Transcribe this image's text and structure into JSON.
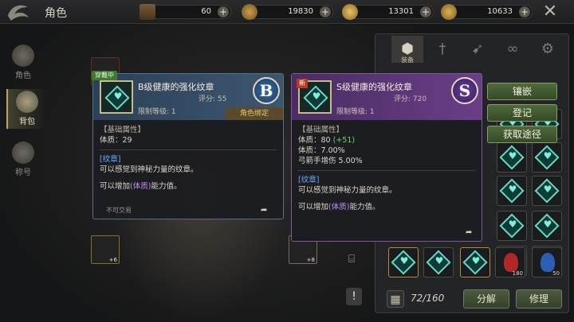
{
  "header": {
    "title": "角色",
    "resources": [
      {
        "name": "tickets",
        "value": "60"
      },
      {
        "name": "fatigue",
        "value": "19830"
      },
      {
        "name": "gold",
        "value": "13301"
      },
      {
        "name": "coin",
        "value": "10633"
      }
    ]
  },
  "left_nav": {
    "items": [
      {
        "label": "角色"
      },
      {
        "label": "背包"
      },
      {
        "label": "称号"
      }
    ]
  },
  "tooltip_equipped": {
    "wearing_badge": "穿戴中",
    "name": "B级健康的强化纹章",
    "score": "评分: 55",
    "level_req": "限制等级: 1",
    "grade_letter": "B",
    "bound": "角色绑定",
    "base_section": "【基础属性】",
    "stats": [
      "体质：29"
    ],
    "desc_title": "[纹章]",
    "desc": "可以感觉到神秘力量的纹章。",
    "effect_prefix": "可以增加",
    "effect_key": "(体质)",
    "effect_suffix": "能力值。",
    "trade": "不可交易"
  },
  "tooltip_new": {
    "new_badge": "新",
    "name": "S级健康的强化纹章",
    "score": "评分: 720",
    "level_req": "限制等级: 1",
    "grade_letter": "S",
    "base_section": "【基础属性】",
    "stat1": "体质：80",
    "stat1_diff": "(+51)",
    "stat2": "体质：7.00%",
    "stat3": "弓箭手增伤 5.00%",
    "desc_title": "[纹章]",
    "desc": "可以感觉到神秘力量的纹章。",
    "effect_prefix": "可以增加",
    "effect_key": "(体质)",
    "effect_suffix": "能力值。"
  },
  "actions": {
    "inlay": "镶嵌",
    "register": "登记",
    "obtain": "获取途径"
  },
  "inventory": {
    "tab_active_label": "装备",
    "capacity": "72/160",
    "decompose": "分解",
    "repair": "修理",
    "item_counts": [
      "180",
      "50"
    ],
    "equip_plus": [
      "+6",
      "+8"
    ]
  },
  "colors": {
    "accent_green": "#4f6a3c",
    "tooltip_b_blue": "#3d5670",
    "tooltip_s_purple": "#6a3e86",
    "diff_green": "#6fd26a"
  }
}
